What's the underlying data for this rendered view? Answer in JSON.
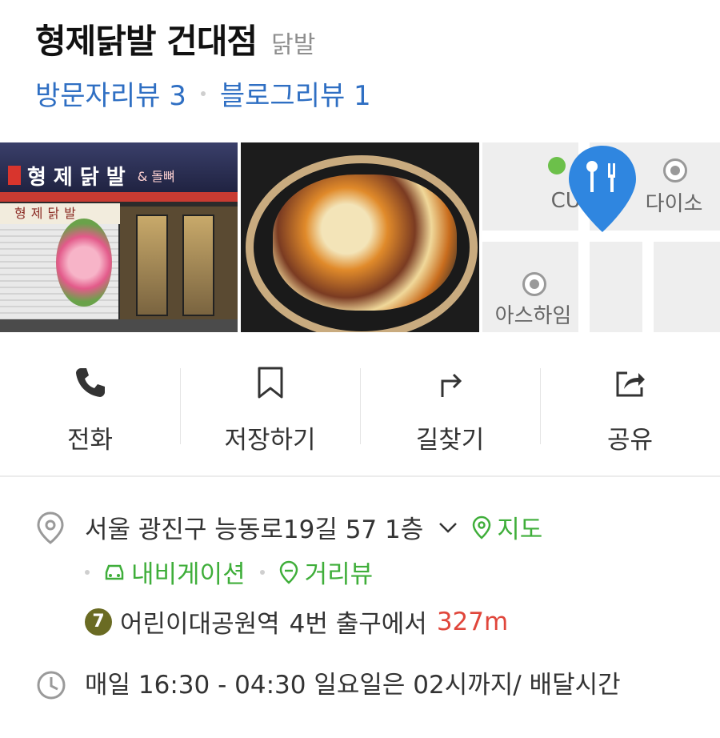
{
  "place": {
    "name": "형제닭발 건대점",
    "category": "닭발"
  },
  "reviews": {
    "visitor_label": "방문자리뷰 3",
    "blog_label": "블로그리뷰 1"
  },
  "photos": {
    "store_sign_text": "형제닭발",
    "store_sign_suffix": "& 돌뼈",
    "store_banner_text": "형제닭발",
    "map_labels": [
      "CU",
      "다이소",
      "아스하임"
    ]
  },
  "actions": [
    {
      "label": "전화",
      "icon": "phone-icon"
    },
    {
      "label": "저장하기",
      "icon": "bookmark-icon"
    },
    {
      "label": "길찾기",
      "icon": "directions-icon"
    },
    {
      "label": "공유",
      "icon": "share-icon"
    }
  ],
  "address": {
    "text": "서울 광진구 능동로19길 57 1층",
    "map_link": "지도",
    "navigation_link": "내비게이션",
    "streetview_link": "거리뷰"
  },
  "subway": {
    "line_number": "7",
    "line_color": "#6a6b23",
    "station": "어린이대공원역",
    "exit_text": "4번 출구에서",
    "distance": "327m"
  },
  "hours": {
    "text": "매일 16:30 - 04:30 일요일은 02시까지/ 배달시간"
  },
  "colors": {
    "link_blue": "#2f6fc3",
    "link_green": "#3fae3a",
    "distance_red": "#e0463b",
    "pin_blue": "#2f86e0"
  }
}
